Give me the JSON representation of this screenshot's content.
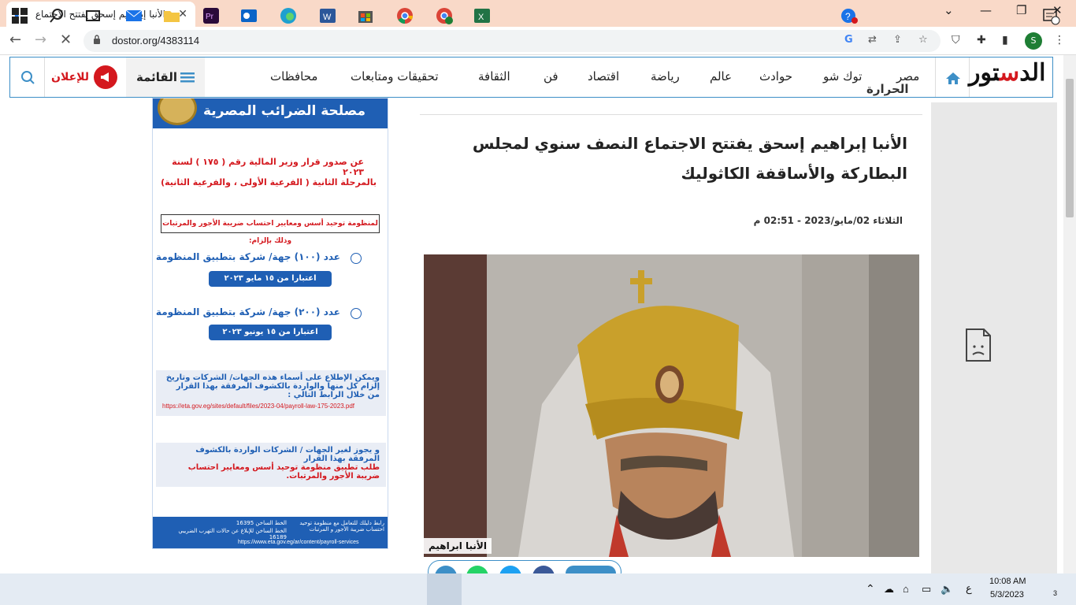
{
  "browser": {
    "tab_title": "الأنبا إبراهيم إسحق يفتتح الاجتماع الن",
    "url": "dostor.org/4383114"
  },
  "site": {
    "logo_text": "الدستور",
    "menu_label": "القائمة",
    "ad_label": "للإعلان",
    "nav": [
      "مصر",
      "توك شو",
      "حوادث",
      "عالم",
      "رياضة",
      "اقتصاد",
      "فن",
      "الثقافة",
      "تحقيقات ومتابعات",
      "محافظات"
    ]
  },
  "ad": {
    "heading": "مصلحة الضرائب المصرية",
    "line1": "عن صدور قرار وزير المالية رقم ( ١٧٥ ) لسنة ٢٠٢٣",
    "line2": "بالمرحلة الثانية ( الفرعية الأولى ، والفرعية الثانية)",
    "box": "لمنظومة توحيد أسس ومعايير احتساب ضريبة الأجور والمرتبات وذلك بإلزام:",
    "count1": "عدد (١٠٠) جهة/ شركة بتطبيق المنظومة",
    "pill1": "اعتبارا من ١٥ مايو ٢٠٢٣",
    "count2": "عدد (٢٠٠) جهة/ شركة بتطبيق المنظومة",
    "pill2": "اعتبارا من ١٥ يونيو ٢٠٢٣",
    "info1": "ويمكن الإطلاع على أسماء هذه الجهات/ الشركات وتاريخ إلزام كل منها والواردة بالكشوف المرفقة بهذا القرار من خلال الرابط التالي :",
    "link1": "https://eta.gov.eg/sites/default/files/2023-04/payroll-law-175-2023.pdf",
    "info2": "و يجوز لغير الجهات / الشركات الواردة بالكشوف المرفقة بهذا القرار",
    "info2_red": "طلب تطبيق منظومة توحيد أسس ومعايير احتساب ضريبة الأجور والمرتبات.",
    "foot1": "رابط دليلك للتعامل مع منظومة توحيد احتساب ضريبة الأجور و المرتبات",
    "foot2": "الخط الساخن 16395",
    "foot3": "الخط الساخن للإبلاغ عن حالات التهرب الضريبي 16189",
    "foot_url": "https://www.eta.gov.eg/ar/content/payroll-services"
  },
  "article": {
    "section": "الحرارة",
    "title": "الأنبا إبراهيم إسحق يفتتح الاجتماع النصف سنوي لمجلس البطاركة والأساقفة الكاثوليك",
    "date": "الثلاثاء 02/مايو/2023 - 02:51 م",
    "caption": "الأنبا ابراهيم"
  },
  "taskbar": {
    "time": "10:08 AM",
    "date": "5/3/2023",
    "lang": "ع",
    "notifications": "3"
  },
  "profile_initial": "S"
}
